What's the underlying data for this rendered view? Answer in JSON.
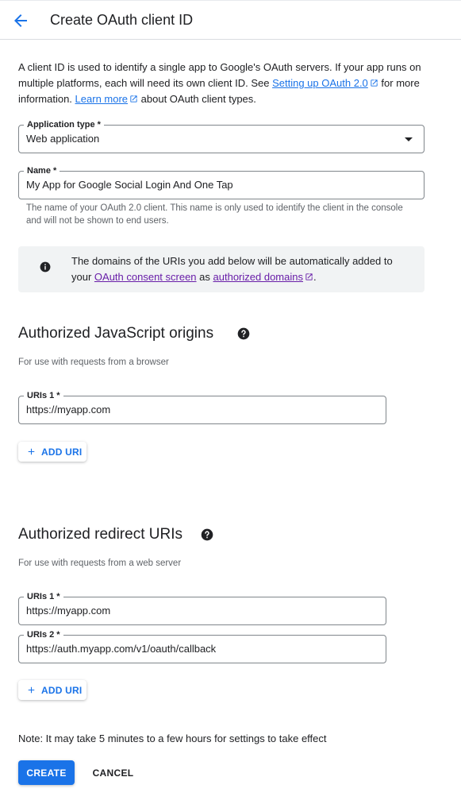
{
  "header": {
    "title": "Create OAuth client ID"
  },
  "intro": {
    "text_1": "A client ID is used to identify a single app to Google's OAuth servers. If your app runs on multiple platforms, each will need its own client ID. See ",
    "link_setup": "Setting up OAuth 2.0",
    "text_2": " for more information. ",
    "link_learn": "Learn more",
    "text_3": " about OAuth client types."
  },
  "application_type": {
    "label": "Application type *",
    "value": "Web application"
  },
  "name_field": {
    "label": "Name *",
    "value": "My App for Google Social Login And One Tap",
    "hint": "The name of your OAuth 2.0 client. This name is only used to identify the client in the console and will not be shown to end users."
  },
  "info": {
    "text_1": "The domains of the URIs you add below will be automatically added to your ",
    "link_consent": "OAuth consent screen",
    "text_2": " as ",
    "link_domains": "authorized domains",
    "text_3": "."
  },
  "js_origins": {
    "heading": "Authorized JavaScript origins",
    "subtitle": "For use with requests from a browser",
    "uris": [
      {
        "label": "URIs 1 *",
        "value": "https://myapp.com"
      }
    ],
    "add_label": "ADD URI"
  },
  "redirect_uris": {
    "heading": "Authorized redirect URIs",
    "subtitle": "For use with requests from a web server",
    "uris": [
      {
        "label": "URIs 1 *",
        "value": "https://myapp.com"
      },
      {
        "label": "URIs 2 *",
        "value": "https://auth.myapp.com/v1/oauth/callback"
      }
    ],
    "add_label": "ADD URI"
  },
  "footer": {
    "note": "Note: It may take 5 minutes to a few hours for settings to take effect",
    "create_label": "CREATE",
    "cancel_label": "CANCEL"
  },
  "colors": {
    "accent": "#1a73e8",
    "visited_link": "#681da8",
    "info_background": "#f1f3f4"
  },
  "icons": {
    "back": "arrow-back-icon",
    "external": "open-in-new-icon",
    "info": "info-icon",
    "help": "help-icon",
    "add": "plus-icon",
    "dropdown": "caret-down-icon"
  }
}
